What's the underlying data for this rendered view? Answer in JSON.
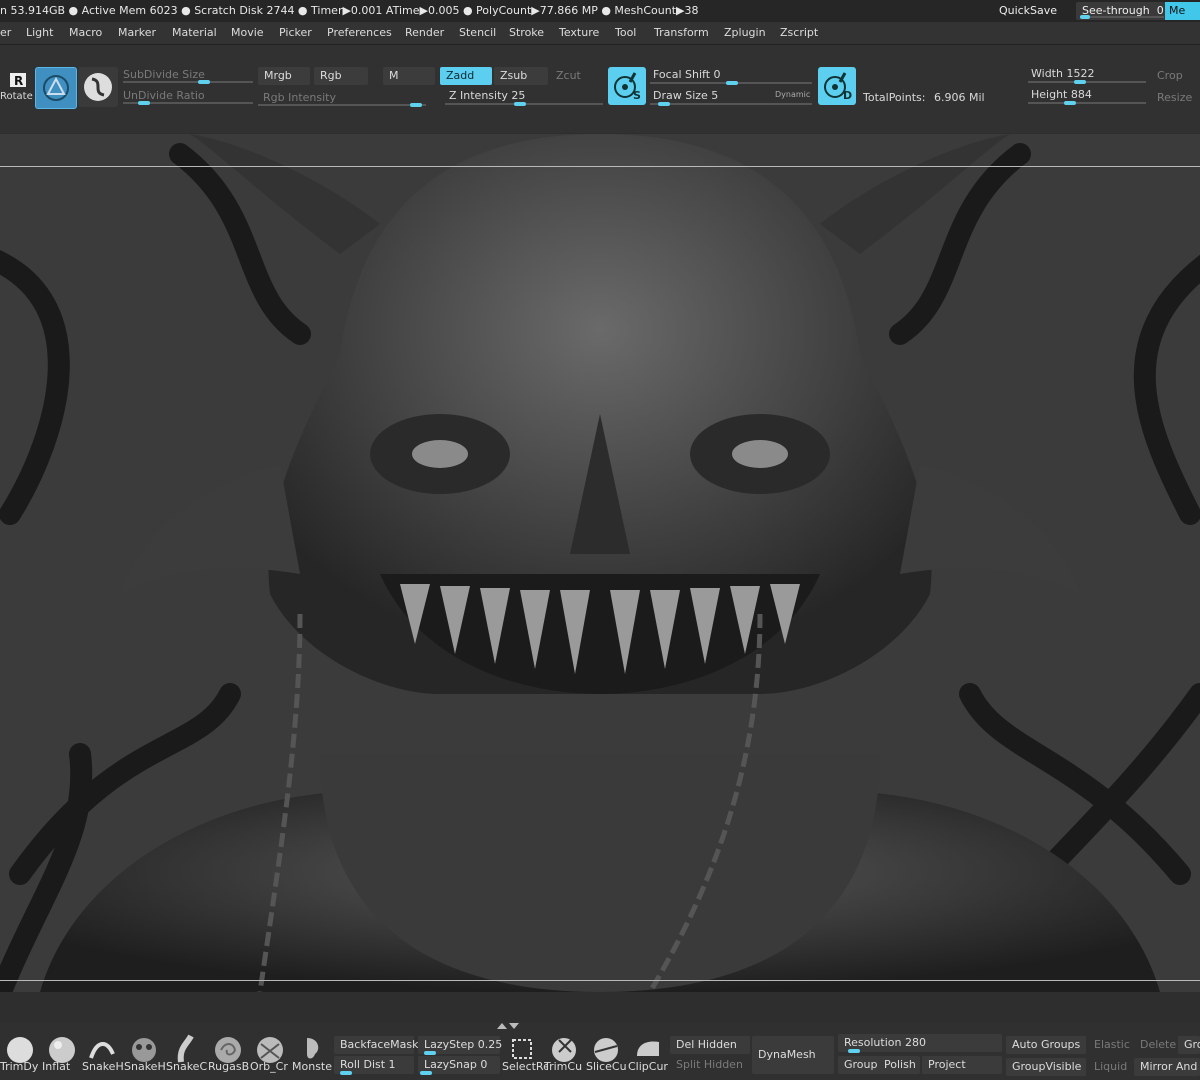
{
  "status": {
    "stats": "n 53.914GB ● Active Mem 6023 ● Scratch Disk 2744 ● Timer▶0.001 ATime▶0.005 ● PolyCount▶77.866 MP ● MeshCount▶38",
    "quicksave": "QuickSave",
    "seethrough_label": "See-through",
    "seethrough_value": "0",
    "corner_button": "Me"
  },
  "menu": [
    "er",
    "Light",
    "Macro",
    "Marker",
    "Material",
    "Movie",
    "Picker",
    "Preferences",
    "Render",
    "Stencil",
    "Stroke",
    "Texture",
    "Tool",
    "Transform",
    "Zplugin",
    "Zscript"
  ],
  "toolbar": {
    "rotate": "Rotate",
    "subdivide_size": "SubDivide Size",
    "undivide_ratio": "UnDivide Ratio",
    "mrgb": "Mrgb",
    "rgb": "Rgb",
    "rgb_intensity": "Rgb Intensity",
    "m": "M",
    "zadd": "Zadd",
    "zsub": "Zsub",
    "zcut": "Zcut",
    "z_intensity": "Z Intensity 25",
    "focal_shift": "Focal Shift 0",
    "draw_size": "Draw Size 5",
    "dynamic": "Dynamic",
    "total_points_label": "TotalPoints:",
    "total_points_value": "6.906 Mil",
    "width": "Width 1522",
    "height": "Height 884",
    "crop": "Crop",
    "resize": "Resize",
    "icon_s": "S",
    "icon_d": "D"
  },
  "shelf": {
    "brushes": [
      "TrimDy",
      "Inflat",
      "SnakeH",
      "SnakeH",
      "SnakeC",
      "RugasB",
      "Orb_Cr",
      "Monste"
    ],
    "backface_mask": "BackfaceMask",
    "roll_dist": "Roll Dist 1",
    "lazy_step": "LazyStep 0.25",
    "lazy_snap": "LazySnap 0",
    "tools": [
      "SelectRe",
      "TrimCu",
      "SliceCu",
      "ClipCur"
    ],
    "del_hidden": "Del Hidden",
    "split_hidden": "Split Hidden",
    "dynamesh": "DynaMesh",
    "resolution": "Resolution 280",
    "groups": "Groups",
    "polish": "Polish",
    "project": "Project",
    "auto_groups": "Auto Groups",
    "group_visible": "GroupVisible",
    "elastic": "Elastic",
    "liquid": "Liquid",
    "delete": "Delete",
    "mirror_and": "Mirror And",
    "gro": "Gro"
  },
  "colors": {
    "accent": "#5ccff0",
    "background": "#2e2e2e",
    "viewport": "#3b3b3b"
  }
}
